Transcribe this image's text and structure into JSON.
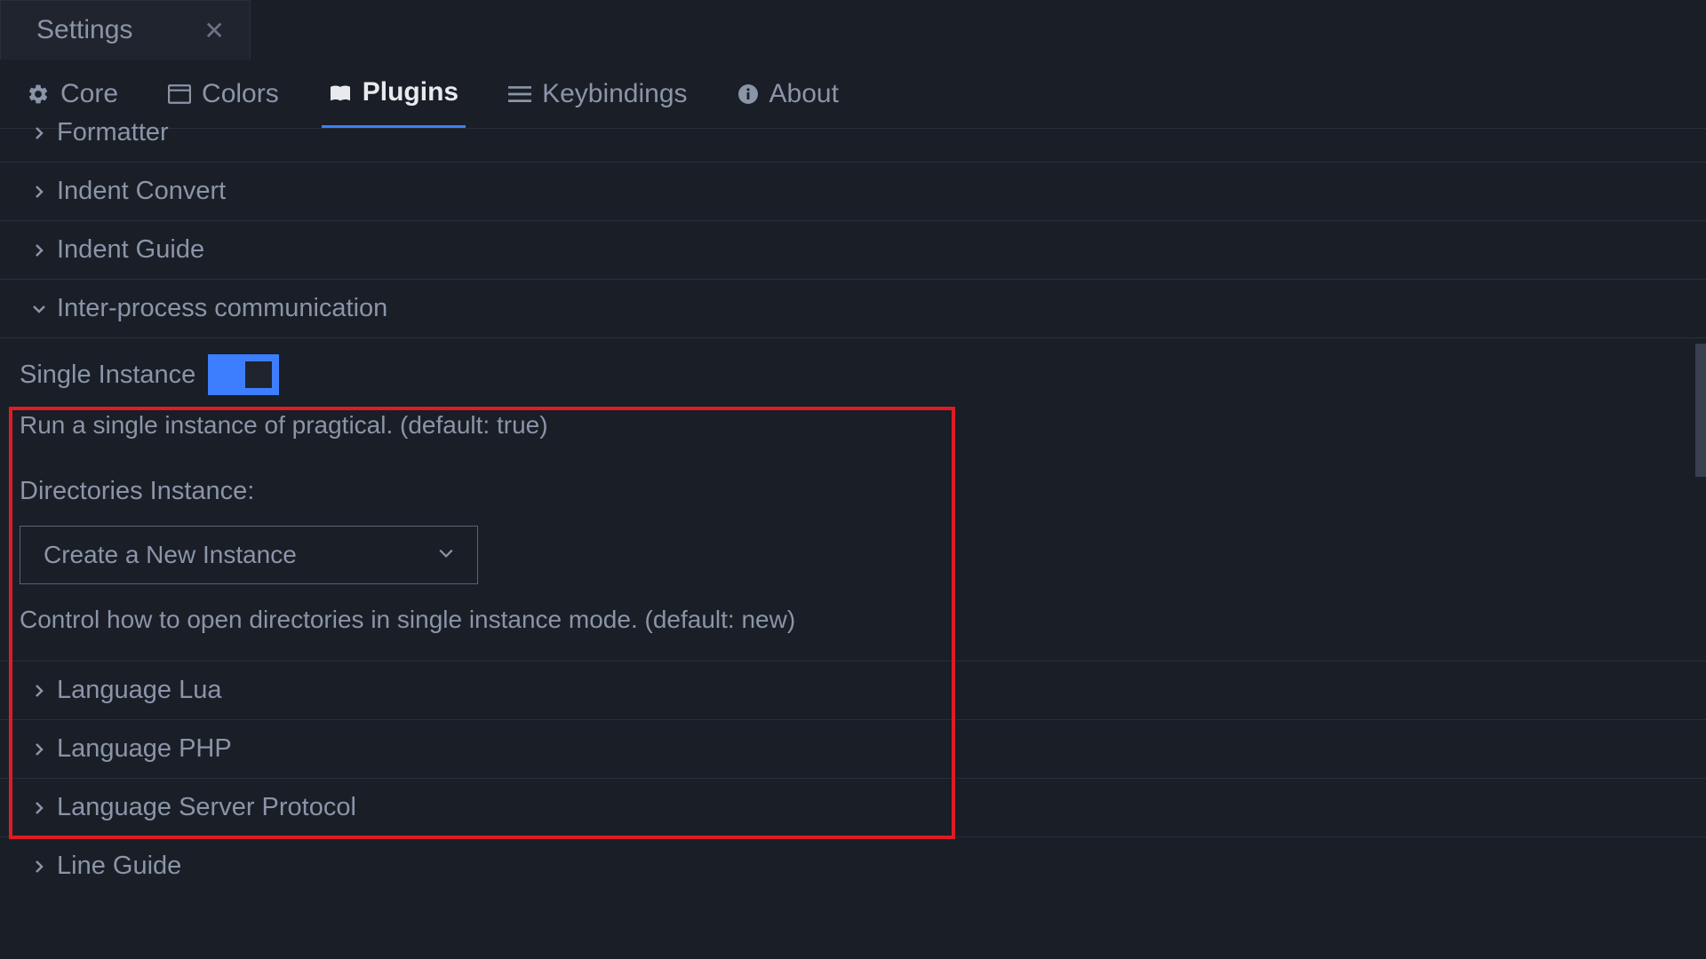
{
  "tab": {
    "title": "Settings"
  },
  "nav": {
    "core": "Core",
    "colors": "Colors",
    "plugins": "Plugins",
    "keybindings": "Keybindings",
    "about": "About"
  },
  "plugins": {
    "formatter": "Formatter",
    "indent_convert": "Indent Convert",
    "indent_guide": "Indent Guide",
    "ipc": "Inter-process communication",
    "language_lua": "Language Lua",
    "language_php": "Language PHP",
    "language_server_protocol": "Language Server Protocol",
    "line_guide": "Line Guide"
  },
  "ipc_settings": {
    "single_instance_label": "Single Instance",
    "single_instance_desc": "Run a single instance of pragtical. (default: true)",
    "single_instance_value": true,
    "directories_instance_label": "Directories Instance:",
    "directories_instance_selected": "Create a New Instance",
    "directories_instance_desc": "Control how to open directories in single instance mode. (default: new)"
  }
}
